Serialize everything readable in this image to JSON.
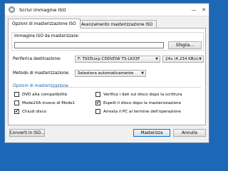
{
  "window": {
    "title": "Scrivi immagine ISO"
  },
  "tabs": [
    {
      "label": "Opzioni di masterizzazione ISO",
      "active": true
    },
    {
      "label": "Avanzamento masterizzazione ISO",
      "active": false
    }
  ],
  "image": {
    "label": "Immagine ISO da masterizzare:",
    "value": "",
    "browse_label": "Sfoglia..."
  },
  "drive": {
    "label": "Periferica destinazione:",
    "selected": "F: TSSTcorp CDDVDW TS-L633F",
    "speed": "24x (4.234 KB/s)"
  },
  "method": {
    "label": "Metodo di masterizzazione:",
    "selected": "Seleziona automaticamente"
  },
  "options": {
    "title": "Opzioni di masterizzazione",
    "items": [
      {
        "label": "DVD alta compatibilità",
        "checked": false
      },
      {
        "label": "Verifica i dati sul disco dopo la scrittura",
        "checked": false
      },
      {
        "label": "Mode2XA invece di Mode1",
        "checked": false
      },
      {
        "label": "Espelli il disco dopo la masterizzazione",
        "checked": true
      },
      {
        "label": "Chiudi disco",
        "checked": true
      },
      {
        "label": "Arresta il PC al termine dell'operazione",
        "checked": false
      }
    ]
  },
  "footer": {
    "convert_label": "Converti in ISO...",
    "burn_label": "Masterizza",
    "cancel_label": "Annulla"
  },
  "colors": {
    "desktop": "#1d68b6",
    "section_title": "#1a5fb4",
    "accent": "#0078d7"
  }
}
